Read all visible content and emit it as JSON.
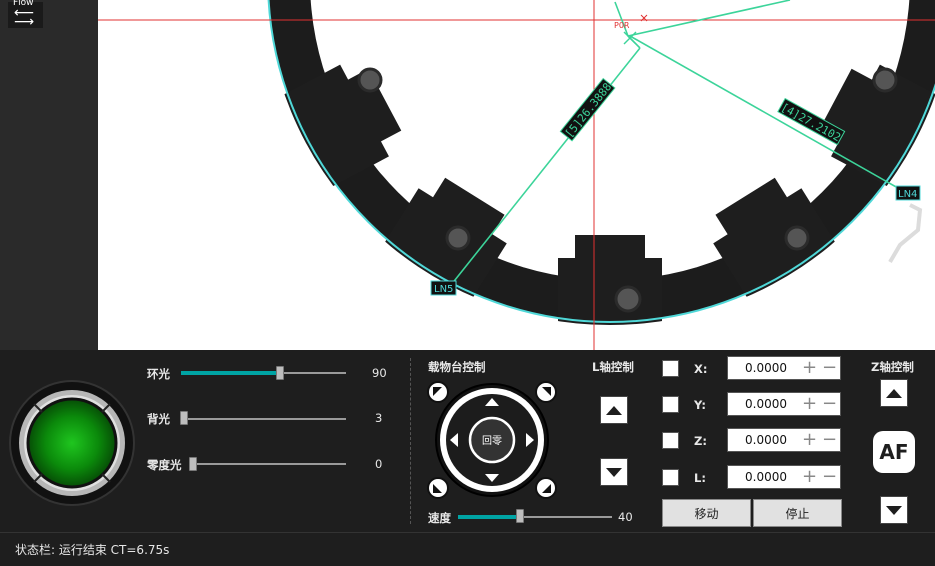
{
  "flow": {
    "label": "Flow",
    "icon": "swap-arrows-icon"
  },
  "overlay": {
    "labels": {
      "ln5": "LN5",
      "ln4": "LN4",
      "p0r": "P0R",
      "m5": "[5]26.3888",
      "m4": "[4]27.2102"
    },
    "colors": {
      "measure": "#3cd49a",
      "crosshair": "#e03030",
      "edge": "#4fd8d8"
    }
  },
  "lights": [
    {
      "label": "环光",
      "value": "90",
      "level": 0.6
    },
    {
      "label": "背光",
      "value": "3",
      "level": 0.02
    },
    {
      "label": "零度光",
      "value": "0",
      "level": 0.0
    }
  ],
  "stage": {
    "title": "载物台控制",
    "home_label": "回零",
    "speed_label": "速度",
    "speed_value": "40",
    "speed_level": 0.4
  },
  "l_axis": {
    "title": "L轴控制"
  },
  "axes": [
    {
      "label": "X:",
      "value": "0.0000"
    },
    {
      "label": "Y:",
      "value": "0.0000"
    },
    {
      "label": "Z:",
      "value": "0.0000"
    },
    {
      "label": "L:",
      "value": "0.0000"
    }
  ],
  "buttons": {
    "move": "移动",
    "stop": "停止"
  },
  "z_axis": {
    "title": "Z轴控制",
    "af_label": "AF"
  },
  "status": {
    "text": "状态栏: 运行结束 CT=6.75s"
  }
}
